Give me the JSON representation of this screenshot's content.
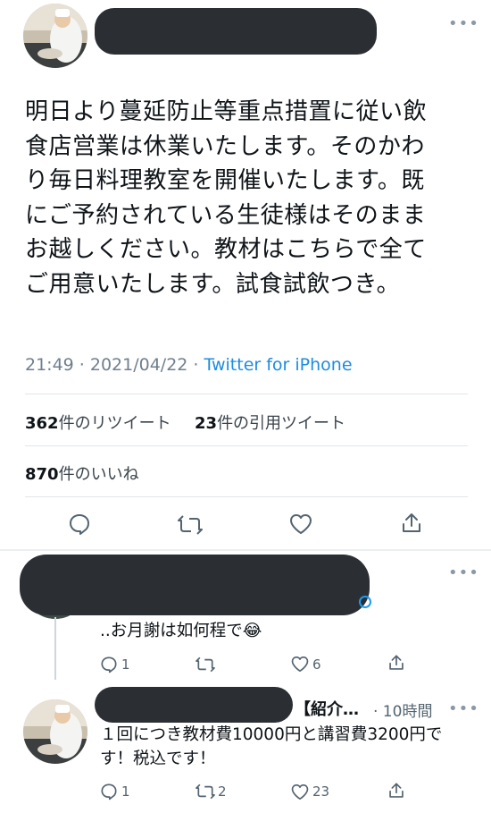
{
  "main_tweet": {
    "text_lines": [
      "明日より蔓延防止等重点措置に従い飲",
      "食店営業は休業いたします。そのかわ",
      "り毎日料理教室を開催いたします。既",
      "にご予約されている生徒様はそのまま",
      "お越しください。教材はこちらで全て",
      "ご用意いたします。試食試飲つき。"
    ],
    "timestamp": "21:49 · 2021/04/22 · ",
    "source": "Twitter for iPhone",
    "retweets_count": "362",
    "retweets_label": "件のリツイート",
    "quotes_count": "23",
    "quotes_label": "件の引用ツイート",
    "likes_count": "870",
    "likes_label": "件のいいね"
  },
  "reply_1": {
    "text": "..お月謝は如何程で",
    "emoji": "😂",
    "reply_count": "1",
    "retweet_count": "",
    "like_count": "6"
  },
  "reply_2": {
    "name": "【紹介…",
    "time": "· 10時間",
    "text_lines": [
      "１回につき教材費10000円と講習費3200円で",
      "す！税込です！"
    ],
    "reply_count": "1",
    "retweet_count": "2",
    "like_count": "23"
  },
  "more_glyph": "•••"
}
